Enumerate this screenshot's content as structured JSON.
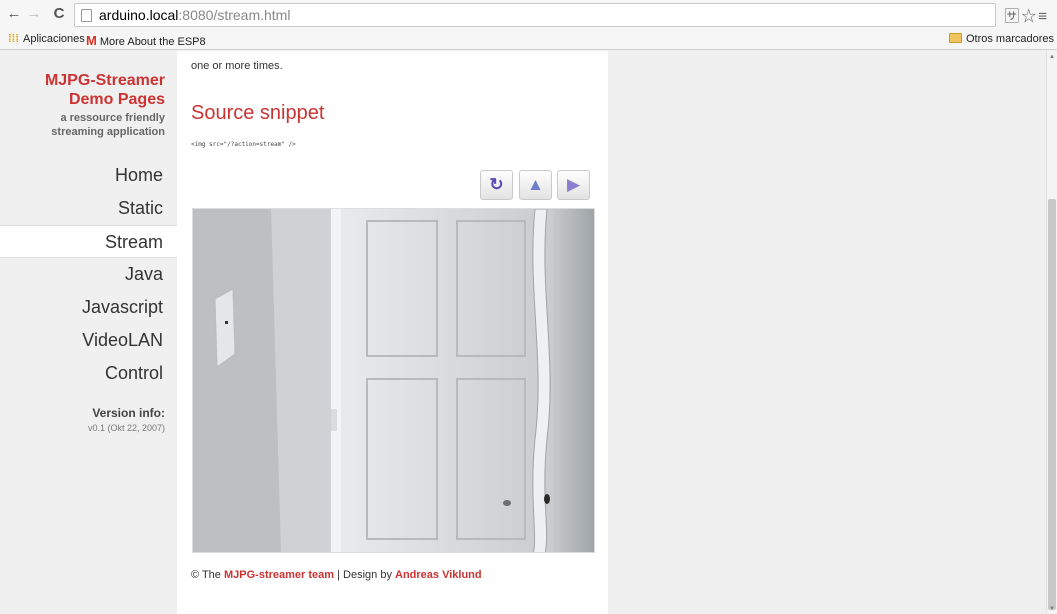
{
  "browser": {
    "url_host": "arduino.local",
    "url_rest": ":8080/stream.html",
    "bookmarks": {
      "apps": "Aplicaciones",
      "esp": "More About the ESP8",
      "other": "Otros marcadores"
    }
  },
  "sidebar": {
    "brand_line1": "MJPG-Streamer",
    "brand_line2": "Demo Pages",
    "tagline1": "a ressource friendly",
    "tagline2": "streaming application",
    "items": [
      {
        "label": "Home"
      },
      {
        "label": "Static"
      },
      {
        "label": "Stream"
      },
      {
        "label": "Java"
      },
      {
        "label": "Javascript"
      },
      {
        "label": "VideoLAN"
      },
      {
        "label": "Control"
      }
    ],
    "version_title": "Version info:",
    "version_value": "v0.1 (Okt 22, 2007)"
  },
  "main": {
    "intro_text": "one or more times.",
    "section_title": "Source snippet",
    "code_snippet": "<img src=\"/?action=stream\" />",
    "image_buttons": [
      "rotate-icon",
      "flip-vertical-icon",
      "flip-horizontal-icon"
    ]
  },
  "footer": {
    "prefix": "© The",
    "team": "MJPG-streamer team",
    "separator": "| Design by",
    "designer": "Andreas Viklund"
  },
  "colors": {
    "brand_red": "#cc3333",
    "sidebar_bg": "#f0f0f0"
  }
}
